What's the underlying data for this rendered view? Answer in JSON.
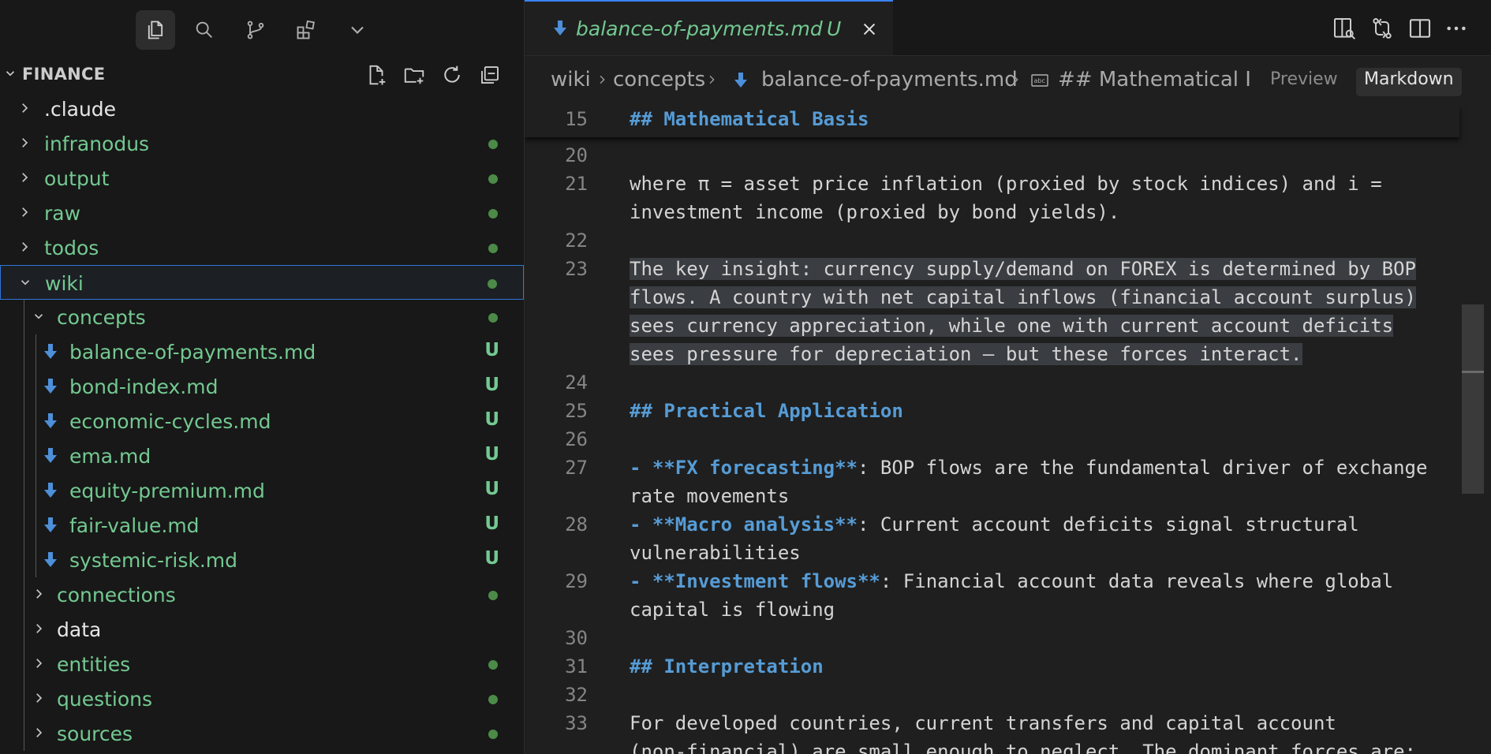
{
  "explorer": {
    "title": "FINANCE",
    "tree": [
      {
        "label": ".claude",
        "level": 0,
        "expanded": false,
        "type": "folder",
        "color": "white",
        "status": ""
      },
      {
        "label": "infranodus",
        "level": 0,
        "expanded": false,
        "type": "folder",
        "color": "green",
        "status": "dot"
      },
      {
        "label": "output",
        "level": 0,
        "expanded": false,
        "type": "folder",
        "color": "green",
        "status": "dot"
      },
      {
        "label": "raw",
        "level": 0,
        "expanded": false,
        "type": "folder",
        "color": "green",
        "status": "dot"
      },
      {
        "label": "todos",
        "level": 0,
        "expanded": false,
        "type": "folder",
        "color": "green",
        "status": "dot"
      },
      {
        "label": "wiki",
        "level": 0,
        "expanded": true,
        "type": "folder",
        "color": "green",
        "status": "dot",
        "selected": true
      },
      {
        "label": "concepts",
        "level": 1,
        "expanded": true,
        "type": "folder",
        "color": "green",
        "status": "dot"
      },
      {
        "label": "balance-of-payments.md",
        "level": 2,
        "type": "file",
        "color": "green",
        "status": "U"
      },
      {
        "label": "bond-index.md",
        "level": 2,
        "type": "file",
        "color": "green",
        "status": "U"
      },
      {
        "label": "economic-cycles.md",
        "level": 2,
        "type": "file",
        "color": "green",
        "status": "U"
      },
      {
        "label": "ema.md",
        "level": 2,
        "type": "file",
        "color": "green",
        "status": "U"
      },
      {
        "label": "equity-premium.md",
        "level": 2,
        "type": "file",
        "color": "green",
        "status": "U"
      },
      {
        "label": "fair-value.md",
        "level": 2,
        "type": "file",
        "color": "green",
        "status": "U"
      },
      {
        "label": "systemic-risk.md",
        "level": 2,
        "type": "file",
        "color": "green",
        "status": "U"
      },
      {
        "label": "connections",
        "level": 1,
        "expanded": false,
        "type": "folder",
        "color": "green",
        "status": "dot"
      },
      {
        "label": "data",
        "level": 1,
        "expanded": false,
        "type": "folder",
        "color": "white",
        "status": ""
      },
      {
        "label": "entities",
        "level": 1,
        "expanded": false,
        "type": "folder",
        "color": "green",
        "status": "dot"
      },
      {
        "label": "questions",
        "level": 1,
        "expanded": false,
        "type": "folder",
        "color": "green",
        "status": "dot"
      },
      {
        "label": "sources",
        "level": 1,
        "expanded": false,
        "type": "folder",
        "color": "green",
        "status": "dot"
      }
    ]
  },
  "tab": {
    "name": "balance-of-payments.md",
    "badge": "U"
  },
  "breadcrumb": {
    "items": [
      "wiki",
      "concepts",
      "balance-of-payments.md",
      "## Mathematical I"
    ]
  },
  "modes": {
    "preview": "Preview",
    "markdown": "Markdown"
  },
  "sticky": {
    "ln": "15",
    "text": "## Mathematical Basis"
  },
  "code_lines": [
    {
      "ln": "20",
      "parts": [
        {
          "t": ""
        }
      ]
    },
    {
      "ln": "21",
      "parts": [
        {
          "t": "where π = asset price inflation (proxied by stock indices) and i ="
        }
      ]
    },
    {
      "ln": "",
      "parts": [
        {
          "t": "investment income (proxied by bond yields)."
        }
      ]
    },
    {
      "ln": "22",
      "parts": [
        {
          "t": ""
        }
      ]
    },
    {
      "ln": "23",
      "parts": [
        {
          "t": "The key insight: currency supply/demand on FOREX is determined by BOP",
          "c": "hl"
        }
      ]
    },
    {
      "ln": "",
      "parts": [
        {
          "t": "flows. A country with net capital inflows (financial account surplus)",
          "c": "hl"
        }
      ]
    },
    {
      "ln": "",
      "parts": [
        {
          "t": "sees currency appreciation, while one with current account deficits",
          "c": "hl"
        }
      ]
    },
    {
      "ln": "",
      "parts": [
        {
          "t": "sees pressure for depreciation — but these forces interact.",
          "c": "hl"
        }
      ]
    },
    {
      "ln": "24",
      "parts": [
        {
          "t": ""
        }
      ]
    },
    {
      "ln": "25",
      "parts": [
        {
          "t": "## Practical Application",
          "c": "hdr"
        }
      ]
    },
    {
      "ln": "26",
      "parts": [
        {
          "t": ""
        }
      ]
    },
    {
      "ln": "27",
      "parts": [
        {
          "t": "- **FX forecasting**",
          "c": "bul"
        },
        {
          "t": ": BOP flows are the fundamental driver of exchange"
        }
      ]
    },
    {
      "ln": "",
      "parts": [
        {
          "t": "rate movements"
        }
      ]
    },
    {
      "ln": "28",
      "parts": [
        {
          "t": "- **Macro analysis**",
          "c": "bul"
        },
        {
          "t": ": Current account deficits signal structural"
        }
      ]
    },
    {
      "ln": "",
      "parts": [
        {
          "t": "vulnerabilities"
        }
      ]
    },
    {
      "ln": "29",
      "parts": [
        {
          "t": "- **Investment flows**",
          "c": "bul"
        },
        {
          "t": ": Financial account data reveals where global"
        }
      ]
    },
    {
      "ln": "",
      "parts": [
        {
          "t": "capital is flowing"
        }
      ]
    },
    {
      "ln": "30",
      "parts": [
        {
          "t": ""
        }
      ]
    },
    {
      "ln": "31",
      "parts": [
        {
          "t": "## Interpretation",
          "c": "hdr"
        }
      ]
    },
    {
      "ln": "32",
      "parts": [
        {
          "t": ""
        }
      ]
    },
    {
      "ln": "33",
      "parts": [
        {
          "t": "For developed countries, current transfers and capital account"
        }
      ]
    },
    {
      "ln": "",
      "parts": [
        {
          "t": "(non-financial) are small enough to neglect. The dominant forces are:"
        }
      ]
    }
  ],
  "colors": {
    "accent": "#3b82f6",
    "git_untracked": "#73c991",
    "heading": "#569cd6"
  }
}
